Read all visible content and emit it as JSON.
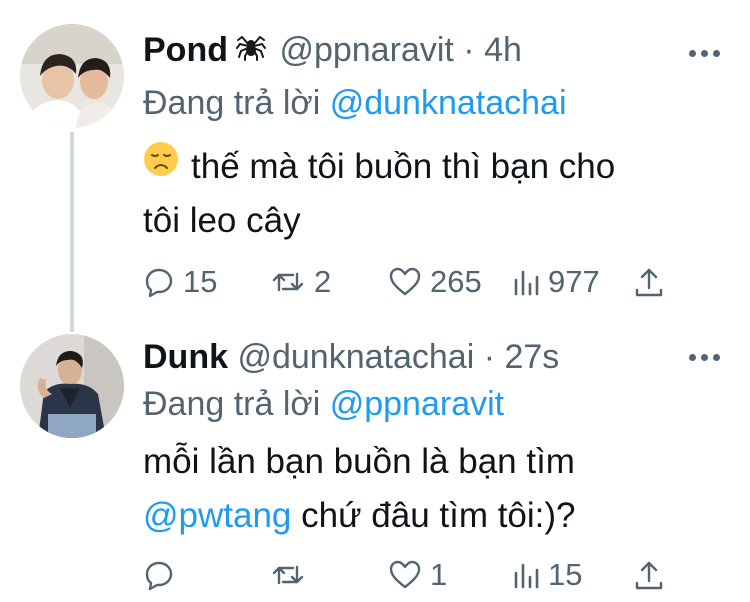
{
  "tweets": [
    {
      "name": "Pond",
      "badge_icon": "spider-icon",
      "handle": "@ppnaravit",
      "separator": "·",
      "time": "4h",
      "replying_label": "Đang trả lời",
      "replying_to": "@dunknatachai",
      "emoji_icon": "disappointed-face-emoji",
      "text_line1": "thế mà tôi buồn thì bạn cho",
      "text_line2": "tôi leo cây",
      "reply_count": "15",
      "retweet_count": "2",
      "like_count": "265",
      "view_count": "977"
    },
    {
      "name": "Dunk",
      "handle": "@dunknatachai",
      "separator": "·",
      "time": "27s",
      "replying_label": "Đang trả lời",
      "replying_to": "@ppnaravit",
      "text_line1": "mỗi lần bạn buồn là bạn tìm",
      "text_line2_mention": "@pwtang",
      "text_line2_rest": "chứ đâu tìm tôi:)?",
      "reply_count": "",
      "retweet_count": "",
      "like_count": "1",
      "view_count": "15"
    }
  ],
  "colors": {
    "text": "#0f1419",
    "secondary": "#536471",
    "link": "#1d9bf0",
    "thread_line": "#cfd9de"
  }
}
